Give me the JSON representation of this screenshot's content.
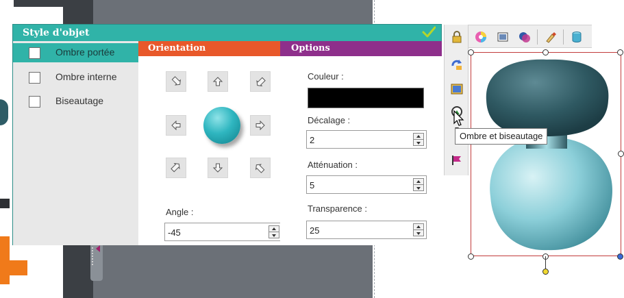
{
  "dialog": {
    "title": "Style d'objet",
    "confirm_icon": "check-icon",
    "left_options": [
      {
        "label": "Ombre portée",
        "checked": false,
        "selected": true
      },
      {
        "label": "Ombre interne",
        "checked": false,
        "selected": false
      },
      {
        "label": "Biseautage",
        "checked": false,
        "selected": false
      }
    ],
    "orientation": {
      "header": "Orientation",
      "directions": [
        "up-left",
        "up",
        "up-right",
        "left",
        "center",
        "right",
        "down-left",
        "down",
        "down-right"
      ],
      "angle_label": "Angle :",
      "angle_value": "-45"
    },
    "options": {
      "header": "Options",
      "color_label": "Couleur :",
      "color_value": "#000000",
      "offset_label": "Décalage :",
      "offset_value": "2",
      "attenuation_label": "Atténuation :",
      "attenuation_value": "5",
      "transparency_label": "Transparence :",
      "transparency_value": "25"
    }
  },
  "toolbar": {
    "top_icons": [
      "lock-icon",
      "color-wheel-icon",
      "image-icon",
      "overlap-circles-icon",
      "brush-icon",
      "cylinder-icon"
    ],
    "side_icons": [
      "rotate-arrow-icon",
      "picture-icon",
      "shadow-bevel-icon",
      "dropdown-arrow-icon",
      "flag-icon"
    ],
    "tooltip": "Ombre et biseautage"
  },
  "colors": {
    "title_bar": "#30b3a8",
    "orientation_header": "#e8582a",
    "options_header": "#8e2f8b",
    "selection_border": "#c23a3a"
  }
}
